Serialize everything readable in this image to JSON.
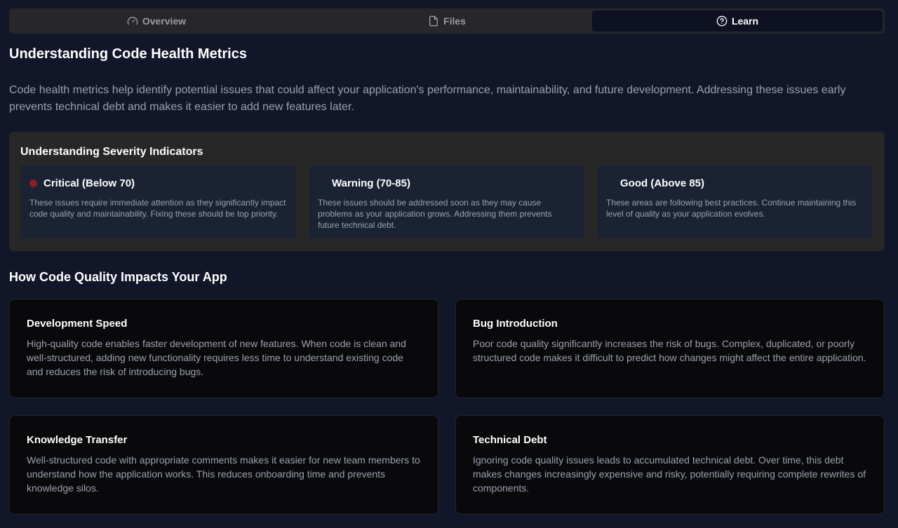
{
  "tabs": [
    {
      "label": "Overview",
      "icon": "gauge-icon",
      "active": false
    },
    {
      "label": "Files",
      "icon": "file-icon",
      "active": false
    },
    {
      "label": "Learn",
      "icon": "help-circle-icon",
      "active": true
    }
  ],
  "main": {
    "title": "Understanding Code Health Metrics",
    "intro": "Code health metrics help identify potential issues that could affect your application's performance, maintainability, and future development. Addressing these issues early prevents technical debt and makes it easier to add new features later."
  },
  "severity": {
    "title": "Understanding Severity Indicators",
    "cards": [
      {
        "title": "Critical (Below 70)",
        "description": "These issues require immediate attention as they significantly impact code quality and maintainability. Fixing these should be top priority.",
        "color": "#8b1d24"
      },
      {
        "title": "Warning (70-85)",
        "description": "These issues should be addressed soon as they may cause problems as your application grows. Addressing them prevents future technical debt.",
        "color": "transparent"
      },
      {
        "title": "Good (Above 85)",
        "description": "These areas are following best practices. Continue maintaining this level of quality as your application evolves.",
        "color": "transparent"
      }
    ]
  },
  "impact": {
    "title": "How Code Quality Impacts Your App",
    "cards": [
      {
        "title": "Development Speed",
        "description": "High-quality code enables faster development of new features. When code is clean and well-structured, adding new functionality requires less time to understand existing code and reduces the risk of introducing bugs."
      },
      {
        "title": "Bug Introduction",
        "description": "Poor code quality significantly increases the risk of bugs. Complex, duplicated, or poorly structured code makes it difficult to predict how changes might affect the entire application."
      },
      {
        "title": "Knowledge Transfer",
        "description": "Well-structured code with appropriate comments makes it easier for new team members to understand how the application works. This reduces onboarding time and prevents knowledge silos."
      },
      {
        "title": "Technical Debt",
        "description": "Ignoring code quality issues leads to accumulated technical debt. Over time, this debt makes changes increasingly expensive and risky, potentially requiring complete rewrites of components."
      }
    ]
  },
  "colors": {
    "background": "#111629",
    "tab_bar": "#272729",
    "active_tab": "#0d1121",
    "card_bg": "#09090b",
    "muted_text": "#9aa1b0"
  }
}
